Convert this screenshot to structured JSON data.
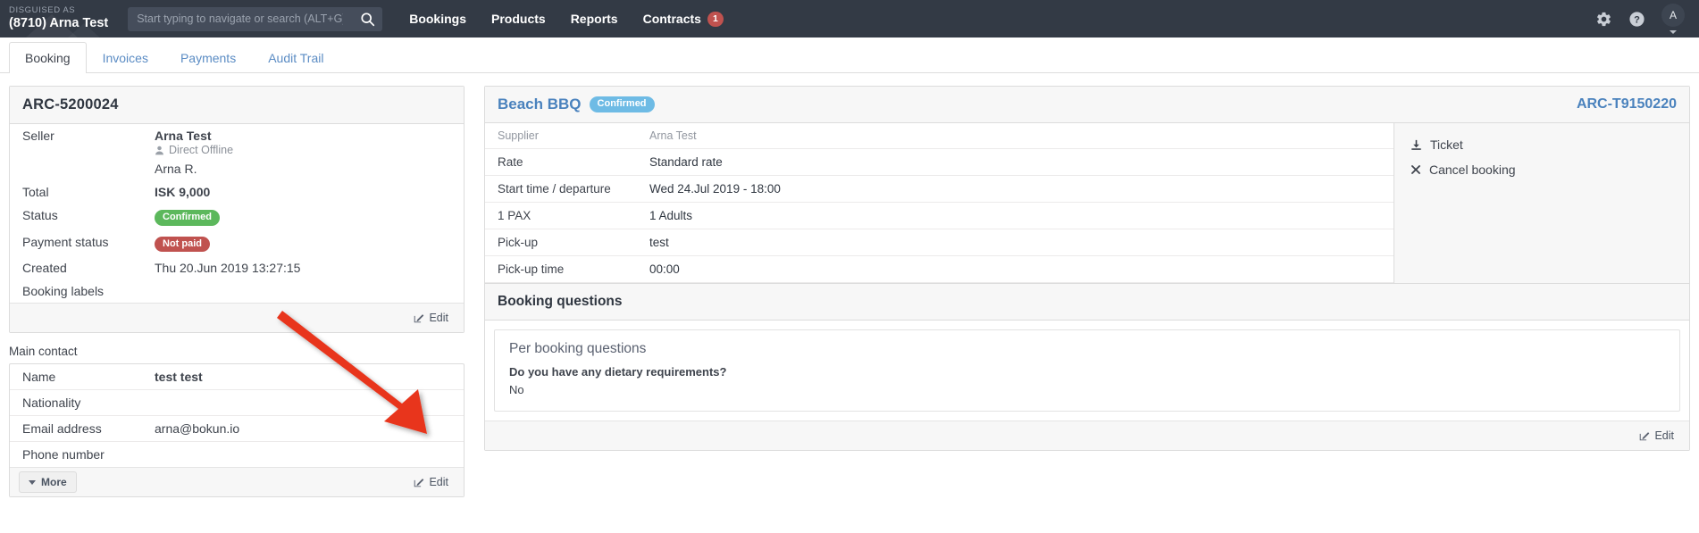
{
  "topbar": {
    "disguised_label": "DISGUISED AS",
    "disguised_user": "(8710) Arna Test",
    "search_placeholder": "Start typing to navigate or search (ALT+G)",
    "search_value": "",
    "nav": [
      {
        "label": "Bookings",
        "badge": ""
      },
      {
        "label": "Products",
        "badge": ""
      },
      {
        "label": "Reports",
        "badge": ""
      },
      {
        "label": "Contracts",
        "badge": "1"
      }
    ],
    "settings_icon": "gear-icon",
    "help_icon": "question-circle-icon",
    "avatar_initial": "A"
  },
  "tabs": [
    {
      "label": "Booking",
      "active": true
    },
    {
      "label": "Invoices",
      "active": false
    },
    {
      "label": "Payments",
      "active": false
    },
    {
      "label": "Audit Trail",
      "active": false
    }
  ],
  "booking_panel": {
    "title": "ARC-5200024",
    "seller_label": "Seller",
    "seller_name": "Arna Test",
    "seller_channel": "Direct Offline",
    "seller_agent": "Arna R.",
    "rows": [
      {
        "key": "Total",
        "value": "ISK 9,000",
        "type": "strong"
      },
      {
        "key": "Status",
        "value": "Confirmed",
        "type": "pill-green"
      },
      {
        "key": "Payment status",
        "value": "Not paid",
        "type": "pill-red"
      },
      {
        "key": "Created",
        "value": "Thu 20.Jun 2019 13:27:15",
        "type": "text"
      },
      {
        "key": "Booking labels",
        "value": "",
        "type": "text"
      }
    ],
    "edit_label": "Edit"
  },
  "main_contact": {
    "section_label": "Main contact",
    "rows": [
      {
        "key": "Name",
        "value": "test test",
        "strong": true
      },
      {
        "key": "Nationality",
        "value": "",
        "strong": false
      },
      {
        "key": "Email address",
        "value": "arna@bokun.io",
        "strong": false
      },
      {
        "key": "Phone number",
        "value": "",
        "strong": false
      }
    ],
    "more_label": "More",
    "edit_label": "Edit"
  },
  "product_panel": {
    "title": "Beach BBQ",
    "status_badge": "Confirmed",
    "reference_code": "ARC-T9150220",
    "rows": [
      {
        "key": "Supplier",
        "value": "Arna Test",
        "muted": true
      },
      {
        "key": "Rate",
        "value": "Standard rate",
        "muted": false
      },
      {
        "key": "Start time / departure",
        "value": "Wed 24.Jul 2019 - 18:00",
        "muted": false
      },
      {
        "key": "1 PAX",
        "value": "1 Adults",
        "muted": false
      },
      {
        "key": "Pick-up",
        "value": "test",
        "muted": false
      },
      {
        "key": "Pick-up time",
        "value": "00:00",
        "muted": false
      }
    ],
    "actions": [
      {
        "label": "Ticket",
        "icon": "download-icon"
      },
      {
        "label": "Cancel booking",
        "icon": "close-x-icon"
      }
    ],
    "questions_title": "Booking questions",
    "questions_group": "Per booking questions",
    "questions": [
      {
        "question": "Do you have any dietary requirements?",
        "answer": "No"
      }
    ],
    "edit_label": "Edit"
  },
  "colors": {
    "topbar_bg": "#333a45",
    "accent_link": "#4a82bd",
    "status_green": "#5cb85c",
    "status_red": "#c0524f",
    "status_blue": "#6ebbe5",
    "annotation_arrow": "#e8361f"
  }
}
